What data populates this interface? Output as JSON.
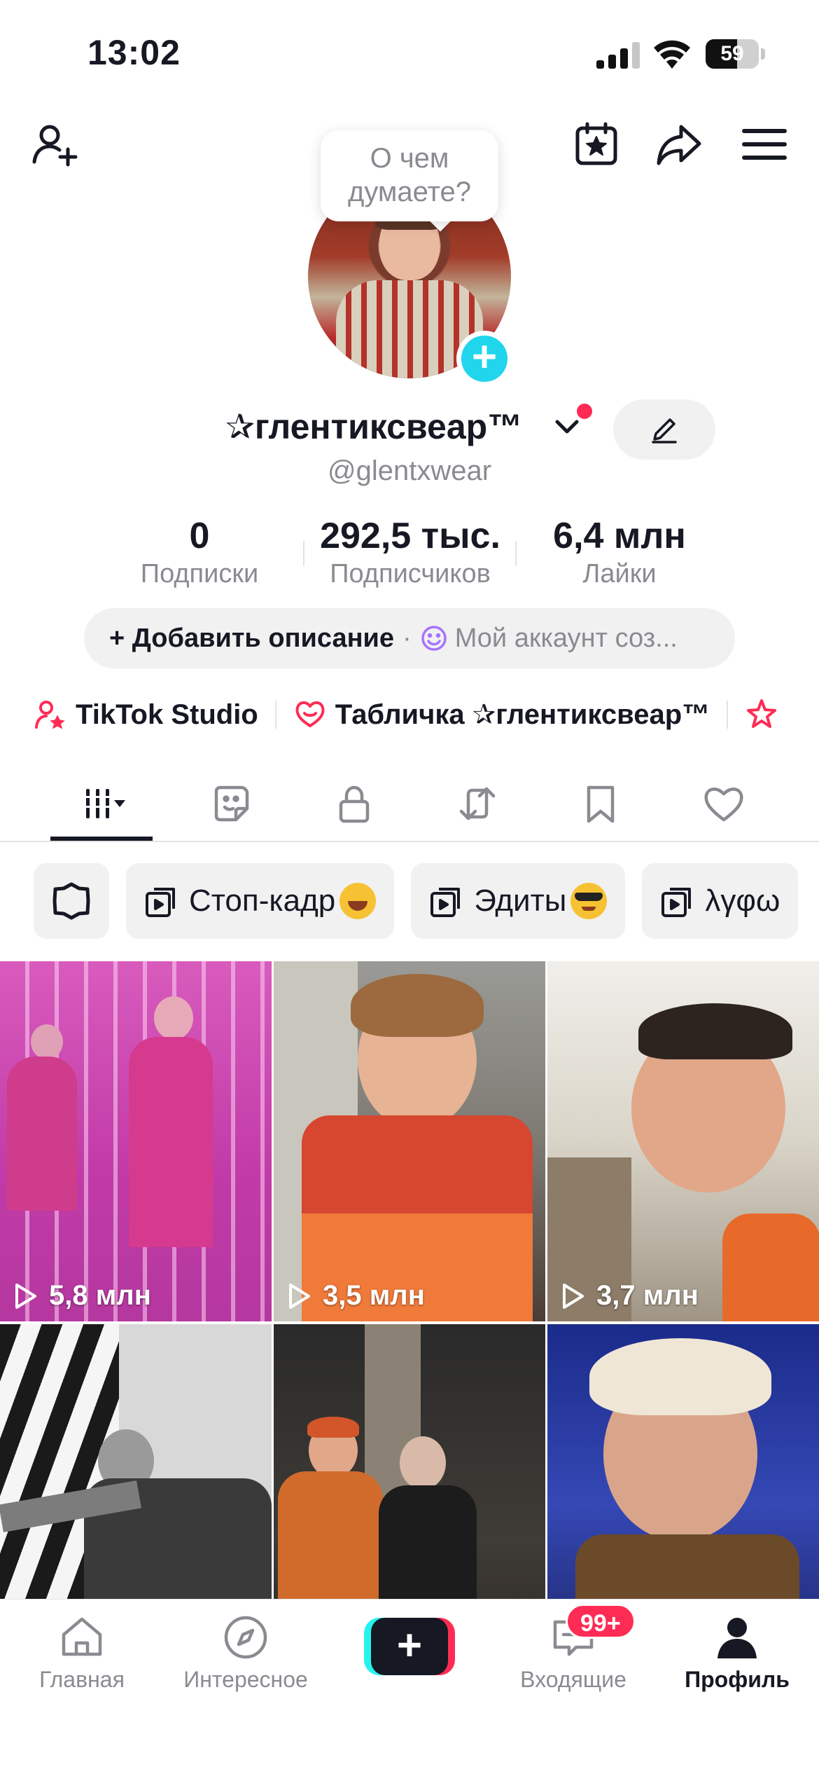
{
  "status_bar": {
    "time": "13:02",
    "battery": "59",
    "battery_fraction": 0.59
  },
  "header": {
    "bubble_text_line1": "О чем",
    "bubble_text_line2": "думаете?"
  },
  "profile": {
    "display_name": "✰глентиксвеар™",
    "username": "@glentxwear",
    "stats": [
      {
        "value": "0",
        "label": "Подписки"
      },
      {
        "value": "292,5 тыс.",
        "label": "Подписчиков"
      },
      {
        "value": "6,4 млн",
        "label": "Лайки"
      }
    ],
    "bio_add_label": "+ Добавить описание",
    "bio_separator": "·",
    "bio_preview": "Мой аккаунт соз..."
  },
  "links": [
    {
      "label": "TikTok Studio",
      "icon": "person-star-icon"
    },
    {
      "label": "Табличка ✰глентиксвеар™",
      "icon": "heart-chat-icon"
    }
  ],
  "tabs": [
    "videos",
    "stickers",
    "private",
    "reposts",
    "saved",
    "liked"
  ],
  "chips": [
    {
      "label": "Стоп-кадр",
      "emoji": "rolling-laugh"
    },
    {
      "label": "Эдиты",
      "emoji": "sunglasses"
    },
    {
      "label": "λγφω"
    }
  ],
  "videos": [
    {
      "views": "5,8 млн"
    },
    {
      "views": "3,5 млн"
    },
    {
      "views": "3,7 млн"
    },
    {
      "views": ""
    },
    {
      "views": ""
    },
    {
      "views": ""
    }
  ],
  "bottom_nav": {
    "home": "Главная",
    "discover": "Интересное",
    "create": "+",
    "inbox": "Входящие",
    "inbox_badge": "99+",
    "profile": "Профиль"
  },
  "colors": {
    "accent_red": "#fe2c55",
    "accent_cyan": "#25f4ee",
    "text_primary": "#161823",
    "text_secondary": "#8a8b91"
  }
}
